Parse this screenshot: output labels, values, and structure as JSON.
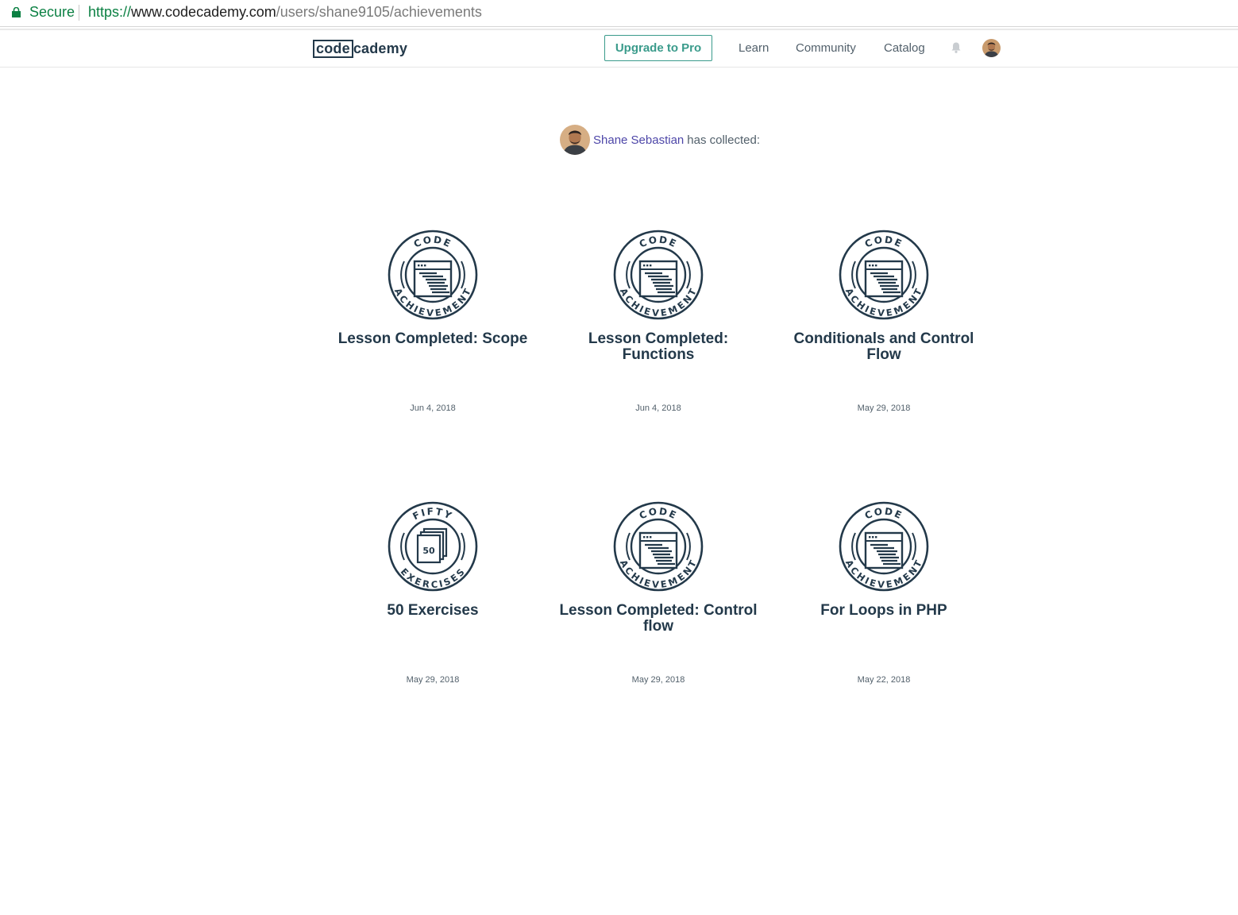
{
  "browser": {
    "secure_label": "Secure",
    "url_scheme": "https://",
    "url_host": "www.codecademy.com",
    "url_path": "/users/shane9105/achievements"
  },
  "header": {
    "logo_boxed": "code",
    "logo_rest": "cademy",
    "upgrade_label": "Upgrade to Pro",
    "nav": {
      "learn": "Learn",
      "community": "Community",
      "catalog": "Catalog"
    },
    "icons": {
      "bell": "bell-icon",
      "avatar": "avatar"
    }
  },
  "collector": {
    "name": "Shane Sebastian",
    "text": "has collected:"
  },
  "colors": {
    "badge": "#23394a",
    "accent_teal": "#3a9b8b",
    "link_purple": "#4d46a8",
    "secure_green": "#0b8043"
  },
  "achievements": [
    {
      "badge_top": "CODE",
      "badge_bottom": "ACHIEVEMENT",
      "icon": "code-window-icon",
      "title": "Lesson Completed: Scope",
      "date": "Jun 4, 2018"
    },
    {
      "badge_top": "CODE",
      "badge_bottom": "ACHIEVEMENT",
      "icon": "code-window-icon",
      "title": "Lesson Completed: Functions",
      "date": "Jun 4, 2018"
    },
    {
      "badge_top": "CODE",
      "badge_bottom": "ACHIEVEMENT",
      "icon": "code-window-icon",
      "title": "Conditionals and Control Flow",
      "date": "May 29, 2018"
    },
    {
      "badge_top": "FIFTY",
      "badge_bottom": "EXERCISES",
      "icon": "stacked-pages-icon",
      "badge_number": "50",
      "title": "50 Exercises",
      "date": "May 29, 2018"
    },
    {
      "badge_top": "CODE",
      "badge_bottom": "ACHIEVEMENT",
      "icon": "code-window-icon",
      "title": "Lesson Completed: Control flow",
      "date": "May 29, 2018"
    },
    {
      "badge_top": "CODE",
      "badge_bottom": "ACHIEVEMENT",
      "icon": "code-window-icon",
      "title": "For Loops in PHP",
      "date": "May 22, 2018"
    }
  ]
}
